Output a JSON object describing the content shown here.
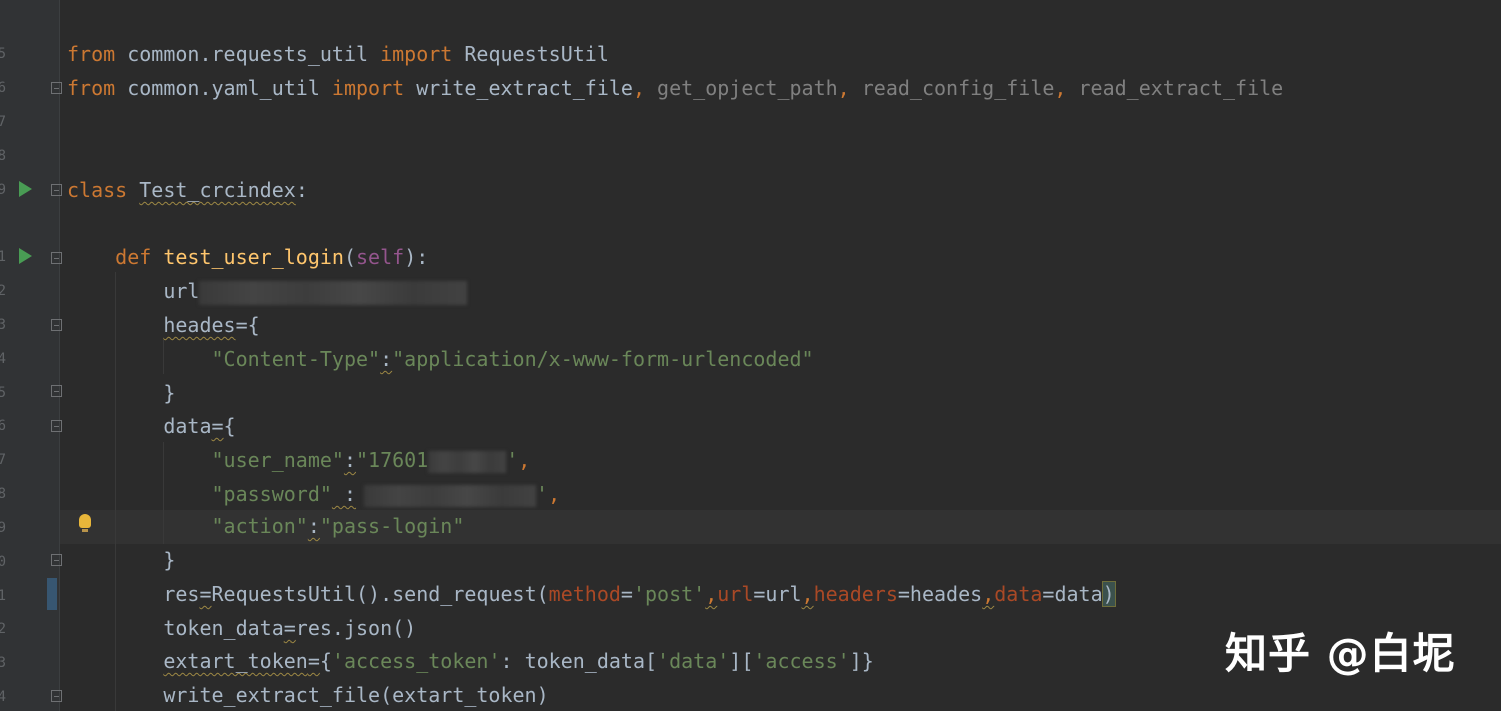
{
  "code": {
    "line1": {
      "from": "from",
      "module": " common.requests_util ",
      "import": "import",
      "name": " RequestsUtil"
    },
    "line2": {
      "from": "from",
      "module": " common.yaml_util ",
      "import": "import",
      "name1": " write_extract_file",
      "comma1": ",",
      "name2": " get_opject_path",
      "comma2": ",",
      "name3": " read_config_file",
      "comma3": ",",
      "name4": " read_extract_file"
    },
    "line3": {
      "class": "class",
      "name": "Test_crcindex",
      "colon": ":"
    },
    "line4": {
      "def": "def",
      "name": "test_user_login",
      "open": "(",
      "self": "self",
      "close": "):"
    },
    "line5": {
      "text": "url"
    },
    "line6": {
      "name": "heades",
      "rest": "={"
    },
    "line7": {
      "key": "\"Content-Type\"",
      "colon": ":",
      "value": "\"application/x-www-form-urlencoded\""
    },
    "line8": {
      "text": "}"
    },
    "line9": {
      "name": "data",
      "eq": "=",
      "brace": "{"
    },
    "line10": {
      "key": "\"user_name\"",
      "colon": ":",
      "value_start": "\"17601",
      "value_end": "'",
      "comma": ","
    },
    "line11": {
      "key": "\"password\"",
      "space_colon": " :",
      "value_end": "'",
      "comma": ","
    },
    "line12": {
      "key": "\"action\"",
      "colon": ":",
      "value": "\"pass-login\""
    },
    "line13": {
      "text": "}"
    },
    "line14": {
      "res": "res",
      "eq": "=",
      "call": "RequestsUtil().send_request",
      "open": "(",
      "p_method": "method",
      "eq1": "=",
      "v_method": "'post'",
      "comma1": ",",
      "p_url": "url",
      "eq2": "=url",
      "comma2": ",",
      "p_headers": "headers",
      "eq3": "=heades",
      "comma3": ",",
      "p_data": "data",
      "eq4": "=data",
      "close": ")"
    },
    "line15": {
      "name": "token_data",
      "eq": "=",
      "rest": "res.json()"
    },
    "line16": {
      "name": "extart_token",
      "eq": "=",
      "open": "{",
      "key": "'access_token'",
      "mid": ": token_data[",
      "k1": "'data'",
      "mid2": "][",
      "k2": "'access'",
      "close": "]}"
    },
    "line17": {
      "text": "write_extract_file(extart_token)"
    }
  },
  "watermark": "知乎 @白坭",
  "colors": {
    "background": "#2b2b2b",
    "keyword": "#cc7832",
    "function": "#ffc66d",
    "string": "#6a8759",
    "self": "#94558d",
    "parameter": "#aa4926",
    "identifier": "#a9b7c6"
  },
  "icons": [
    "run-icon",
    "fold-icon",
    "lightbulb-icon"
  ]
}
